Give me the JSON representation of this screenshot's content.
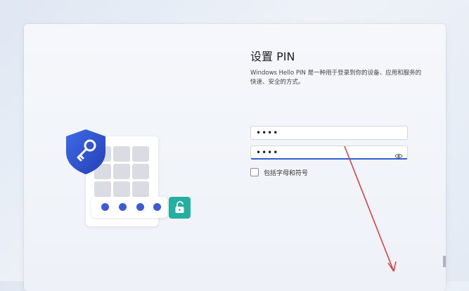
{
  "setup": {
    "title": "设置 PIN",
    "description": "Windows Hello PIN 是一种用于登录到你的设备、应用和服务的快速、安全的方式。",
    "new_pin_value": "••••",
    "confirm_pin_value": "••••",
    "include_letters_label": "包括字母和符号"
  },
  "icons": {
    "shield": "shield-key-icon",
    "lock": "unlock-icon",
    "eye": "eye-icon"
  },
  "colors": {
    "accent": "#2f5fd0",
    "shield": "#2f55d4",
    "lock": "#23b0a0",
    "annotation_arrow": "#d93a3a"
  }
}
